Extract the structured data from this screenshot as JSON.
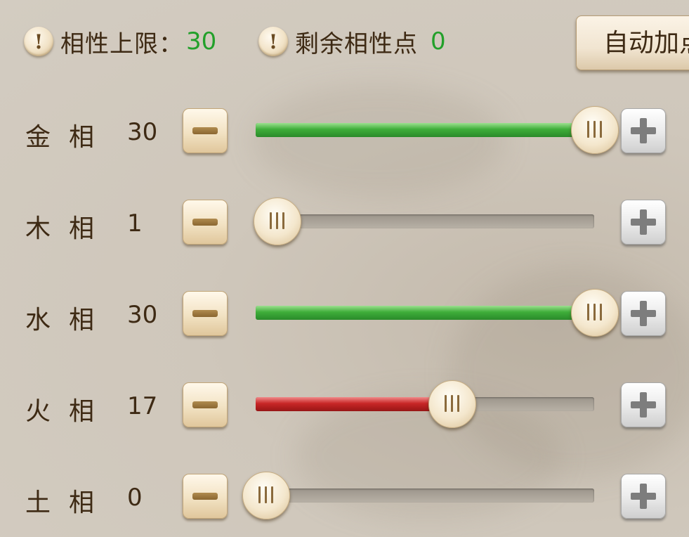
{
  "header": {
    "cap_label": "相性上限：",
    "cap_value": "30",
    "remaining_label": "剩余相性点",
    "remaining_value": "0",
    "warn_glyph": "!",
    "auto_button_label": "自动加点"
  },
  "slider_max": 30,
  "colors": {
    "value_green": "#22a02a",
    "fill_green": "#3fae3a",
    "fill_red": "#c82626",
    "text_brown": "#3e2a14"
  },
  "attributes": [
    {
      "label": "金相",
      "value": "30",
      "level": 30,
      "fill": "green"
    },
    {
      "label": "木相",
      "value": "1",
      "level": 1,
      "fill": "green"
    },
    {
      "label": "水相",
      "value": "30",
      "level": 30,
      "fill": "green"
    },
    {
      "label": "火相",
      "value": "17",
      "level": 17,
      "fill": "red"
    },
    {
      "label": "土相",
      "value": "0",
      "level": 0,
      "fill": "green"
    }
  ],
  "icons": {
    "warn": "exclamation-icon",
    "minus": "minus-icon",
    "plus": "plus-icon",
    "thumb": "slider-grip-icon"
  }
}
